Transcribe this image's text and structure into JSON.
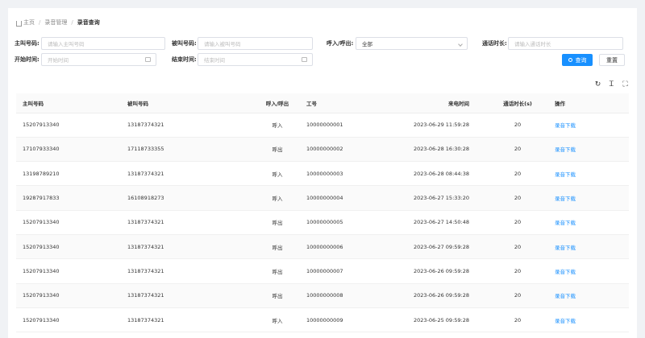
{
  "breadcrumb": {
    "home": "主页",
    "section": "录音管理",
    "current": "录音查询"
  },
  "filters": {
    "caller": {
      "label": "主叫号码:",
      "placeholder": "请输入主叫号码"
    },
    "callee": {
      "label": "被叫号码:",
      "placeholder": "请输入被叫号码"
    },
    "direction": {
      "label": "呼入/呼出:",
      "value": "全部"
    },
    "duration": {
      "label": "通话时长:",
      "placeholder": "请输入通话时长"
    },
    "start": {
      "label": "开始时间:",
      "placeholder": "开始时间"
    },
    "end": {
      "label": "结束时间:",
      "placeholder": "结束时间"
    }
  },
  "buttons": {
    "search": "查询",
    "reset": "重置"
  },
  "table": {
    "headers": [
      "主叫号码",
      "被叫号码",
      "呼入/呼出",
      "工号",
      "来电时间",
      "通话时长(s)",
      "操作"
    ],
    "action_label": "录音下载",
    "rows": [
      [
        "15207913340",
        "13187374321",
        "呼入",
        "10000000001",
        "2023-06-29 11:59:28",
        "20"
      ],
      [
        "17107933340",
        "17118733355",
        "呼出",
        "10000000002",
        "2023-06-28 16:30:28",
        "20"
      ],
      [
        "13198789210",
        "13187374321",
        "呼入",
        "10000000003",
        "2023-06-28 08:44:38",
        "20"
      ],
      [
        "19287917833",
        "16108918273",
        "呼入",
        "10000000004",
        "2023-06-27 15:33:20",
        "20"
      ],
      [
        "15207913340",
        "13187374321",
        "呼出",
        "10000000005",
        "2023-06-27 14:50:48",
        "20"
      ],
      [
        "15207913340",
        "13187374321",
        "呼出",
        "10000000006",
        "2023-06-27 09:59:28",
        "20"
      ],
      [
        "15207913340",
        "13187374321",
        "呼出",
        "10000000007",
        "2023-06-26 09:59:28",
        "20"
      ],
      [
        "15207913340",
        "13187374321",
        "呼出",
        "10000000008",
        "2023-06-26 09:59:28",
        "20"
      ],
      [
        "15207913340",
        "13187374321",
        "呼入",
        "10000000009",
        "2023-06-25 09:59:28",
        "20"
      ]
    ]
  }
}
